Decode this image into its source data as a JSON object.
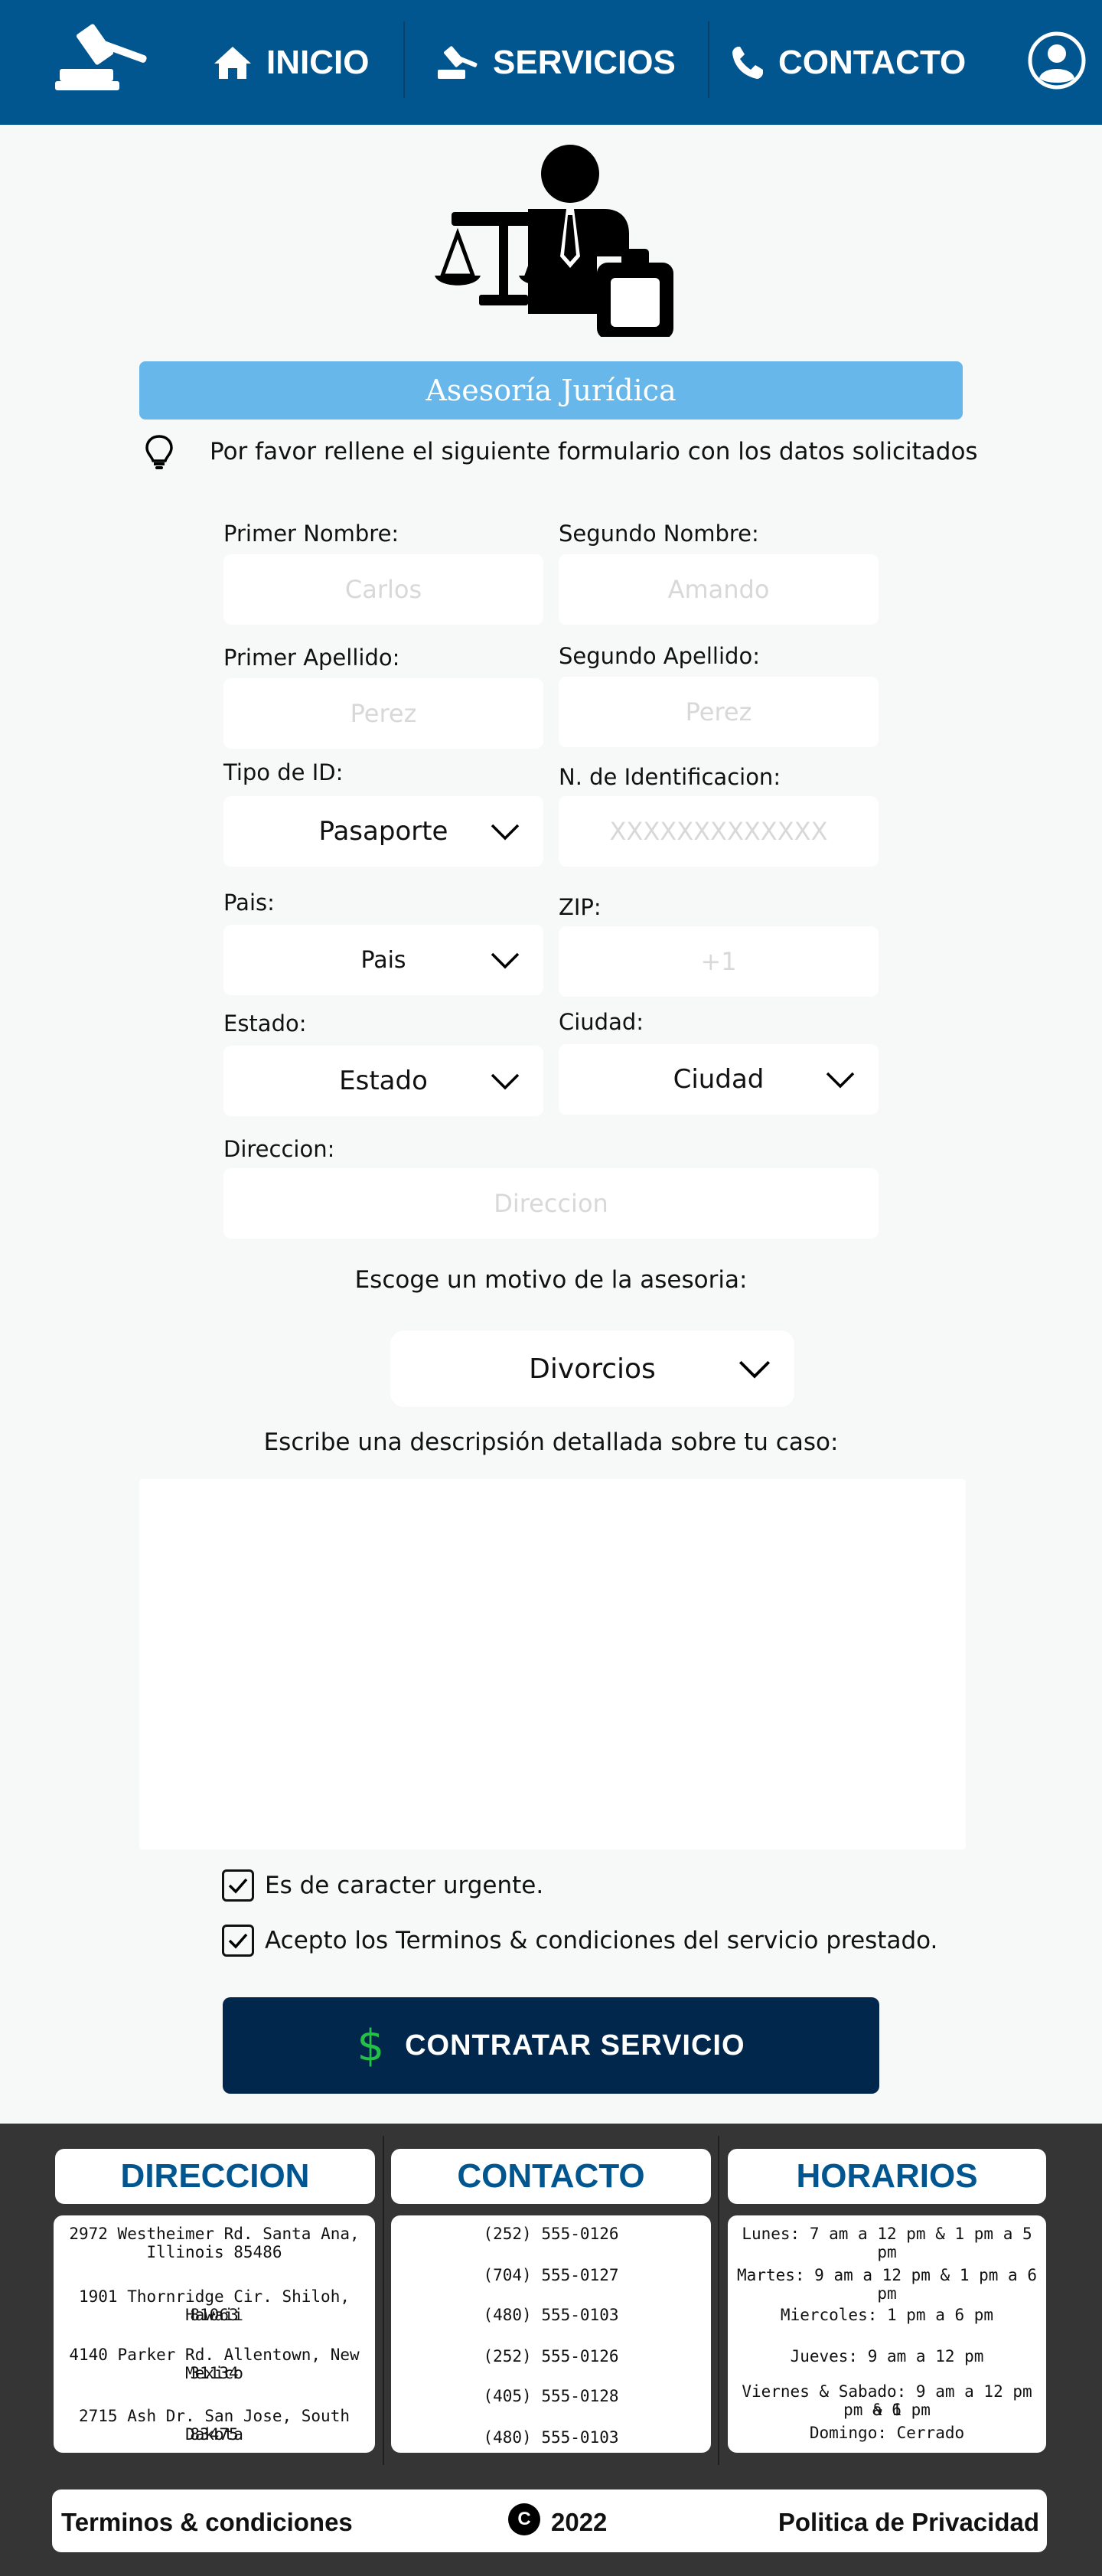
{
  "nav": {
    "inicio": "INICIO",
    "servicios": "SERVICIOS",
    "contacto": "CONTACTO"
  },
  "hero": {
    "title": "Asesoría Jurídica",
    "hint": "Por favor rellene el siguiente formulario con los datos solicitados"
  },
  "form": {
    "primer_nombre": {
      "label": "Primer Nombre:",
      "placeholder": "Carlos"
    },
    "segundo_nombre": {
      "label": "Segundo Nombre:",
      "placeholder": "Amando"
    },
    "primer_apellido": {
      "label": "Primer Apellido:",
      "placeholder": "Perez"
    },
    "segundo_apellido": {
      "label": "Segundo Apellido:",
      "placeholder": "Perez"
    },
    "tipo_id": {
      "label": "Tipo de ID:",
      "value": "Pasaporte"
    },
    "n_identificacion": {
      "label": "N. de Identificacion:",
      "placeholder": "XXXXXXXXXXXXX"
    },
    "pais": {
      "label": "Pais:",
      "value": "Pais"
    },
    "zip": {
      "label": "ZIP:",
      "placeholder": "+1"
    },
    "estado": {
      "label": "Estado:",
      "value": "Estado"
    },
    "ciudad": {
      "label": "Ciudad:",
      "value": "Ciudad"
    },
    "direccion": {
      "label": "Direccion:",
      "placeholder": "Direccion"
    },
    "motivo": {
      "label": "Escoge un motivo de la asesoria:",
      "value": "Divorcios"
    },
    "descripcion": {
      "label": "Escribe una descripsión detallada sobre tu caso:"
    },
    "urgente": "Es de caracter urgente.",
    "terminos": "Acepto los Terminos & condiciones del servicio prestado.",
    "submit": "CONTRATAR SERVICIO",
    "submit_icon": "$"
  },
  "footer": {
    "direccion": {
      "title": "DIRECCION",
      "lines": [
        "2972 Westheimer Rd. Santa Ana,",
        "Illinois 85486",
        "1901 Thornridge Cir. Shiloh, Hawaii",
        "81063",
        "4140 Parker Rd. Allentown, New Mexico",
        "31134",
        "2715 Ash Dr. San Jose, South Dakota",
        "83475"
      ]
    },
    "contacto": {
      "title": "CONTACTO",
      "lines": [
        "(252) 555-0126",
        "(704) 555-0127",
        "(480) 555-0103",
        "(252) 555-0126",
        "(405) 555-0128",
        "(480) 555-0103"
      ]
    },
    "horarios": {
      "title": "HORARIOS",
      "lines": [
        "Lunes: 7 am a 12 pm & 1 pm a 5 pm",
        "Martes: 9 am a 12 pm & 1 pm a 6 pm",
        "Miercoles: 1 pm a 6 pm",
        "Jueves: 9 am a 12 pm",
        "Viernes & Sabado: 9 am a 12 pm & 1",
        "pm a 6 pm",
        "Domingo: Cerrado"
      ]
    },
    "terminos": "Terminos & condiciones",
    "copyright_icon": "C",
    "year": "2022",
    "privacidad": "Politica de Privacidad"
  },
  "colors": {
    "header": "#02568f",
    "title_bar": "#67b7ea",
    "submit": "#01284c",
    "footer": "#353535",
    "dollar": "#23c146"
  },
  "icons": [
    "gavel-icon",
    "home-icon",
    "gavel-small-icon",
    "phone-icon",
    "user-icon",
    "lawyer-icon",
    "lightbulb-icon",
    "chevron-down-icon",
    "checkmark-icon",
    "dollar-icon",
    "copyright-icon"
  ]
}
